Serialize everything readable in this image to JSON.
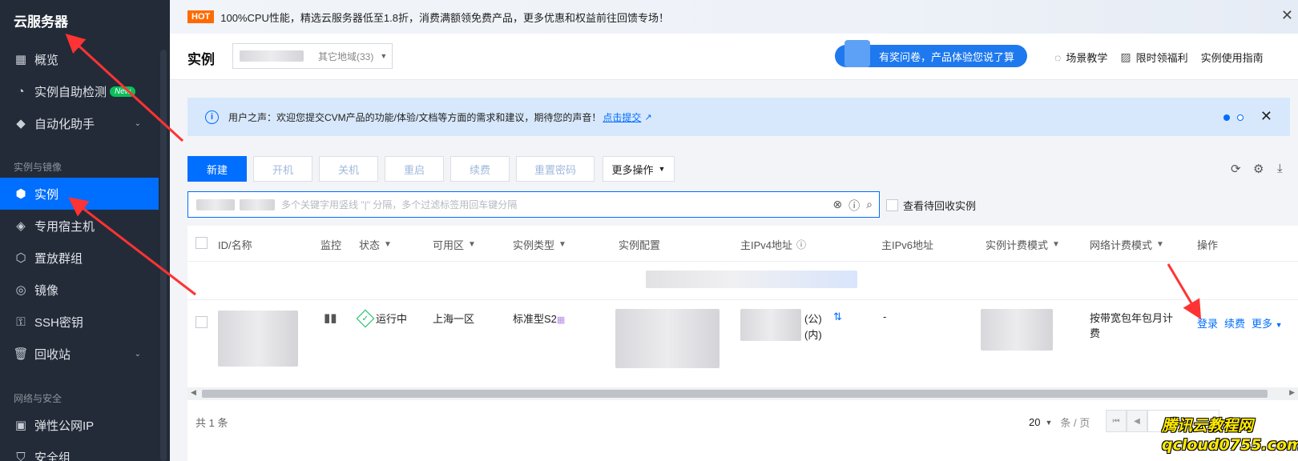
{
  "sidebar": {
    "brand": "云服务器",
    "items": [
      {
        "label": "概览",
        "icon": "grid-icon"
      },
      {
        "label": "实例自助检测",
        "icon": "gauge-icon",
        "badge": "New"
      },
      {
        "label": "自动化助手",
        "icon": "graduation-icon",
        "chevron": true
      },
      {
        "label": "实例",
        "icon": "cube-icon",
        "active": true
      },
      {
        "label": "专用宿主机",
        "icon": "layers-icon"
      },
      {
        "label": "置放群组",
        "icon": "group-icon"
      },
      {
        "label": "镜像",
        "icon": "disc-icon"
      },
      {
        "label": "SSH密钥",
        "icon": "key-icon"
      },
      {
        "label": "回收站",
        "icon": "trash-icon",
        "chevron": true
      },
      {
        "label": "弹性公网IP",
        "icon": "ip-icon"
      },
      {
        "label": "安全组",
        "icon": "shield-icon"
      }
    ],
    "groups": [
      "实例与镜像",
      "网络与安全"
    ]
  },
  "banner": {
    "hot": "HOT",
    "text": "100%CPU性能，精选云服务器低至1.8折，消费满额领免费产品，更多优惠和权益前往回馈专场！"
  },
  "header": {
    "title": "实例",
    "region_other": "其它地域(33)",
    "survey": "有奖问卷，产品体验您说了算",
    "links": [
      "场景教学",
      "限时领福利",
      "实例使用指南"
    ]
  },
  "notice": {
    "text": "用户之声：欢迎您提交CVM产品的功能/体验/文档等方面的需求和建议，期待您的声音！",
    "link": "点击提交"
  },
  "toolbar": {
    "new": "新建",
    "start": "开机",
    "stop": "关机",
    "restart": "重启",
    "renew": "续费",
    "reset_password": "重置密码",
    "more": "更多操作"
  },
  "search": {
    "placeholder": "多个关键字用竖线 \"|\" 分隔，多个过滤标签用回车键分隔",
    "recycle_label": "查看待回收实例"
  },
  "table": {
    "columns": [
      "ID/名称",
      "监控",
      "状态",
      "可用区",
      "实例类型",
      "实例配置",
      "主IPv4地址",
      "主IPv6地址",
      "实例计费模式",
      "网络计费模式",
      "操作"
    ],
    "row": {
      "status": "运行中",
      "zone": "上海一区",
      "type": "标准型S2",
      "ip_public_suffix": "(公)",
      "ip_private_suffix": "(内)",
      "ipv6": "-",
      "network_billing": "按带宽包年包月计费",
      "ops": [
        "登录",
        "续费",
        "更多"
      ]
    },
    "footer": {
      "total": "共 1 条",
      "page_size": "20",
      "page_unit": "条 / 页"
    }
  },
  "watermark": {
    "line1": "腾讯云教程网",
    "line2": "qcloud0755.com"
  },
  "colors": {
    "sidebar_bg": "#232b38",
    "primary": "#006eff",
    "hot": "#ff6a00",
    "success": "#0abf5b",
    "arrow": "#ff3333"
  }
}
